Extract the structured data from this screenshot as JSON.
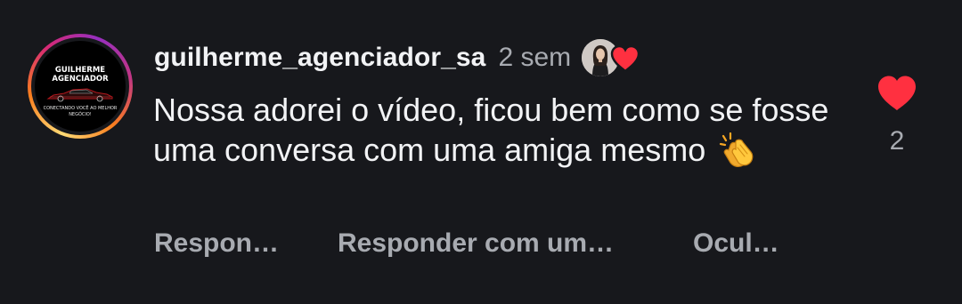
{
  "comment": {
    "avatar": {
      "logo_line1": "GUILHERME",
      "logo_line2": "AGENCIADOR",
      "logo_tagline": "CONECTANDO VOCÊ AO MELHOR NEGÓCIO!"
    },
    "username": "guilherme_agenciador_sa",
    "time": "2 sem",
    "creator_liked": true,
    "text_before_emoji": "Nossa adorei o vídeo, ficou bem como se fosse uma conversa com uma amiga mesmo",
    "emoji": "clapping-hands",
    "actions": {
      "reply": "Respon…",
      "reply_with": "Responder com um…",
      "hide": "Ocul…"
    },
    "like_count": "2",
    "liked": true
  },
  "colors": {
    "background": "#17181c",
    "primary_text": "#f2f3f5",
    "secondary_text": "#a8abb1",
    "heart": "#ff3040"
  }
}
